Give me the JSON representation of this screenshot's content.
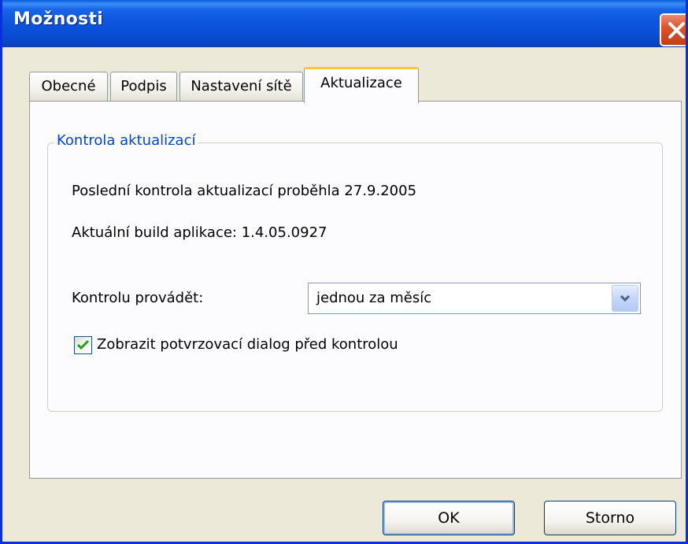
{
  "window": {
    "title": "Možnosti"
  },
  "tabs": [
    {
      "label": "Obecné"
    },
    {
      "label": "Podpis"
    },
    {
      "label": "Nastavení sítě"
    },
    {
      "label": "Aktualizace"
    }
  ],
  "update_group": {
    "legend": "Kontrola aktualizací",
    "last_check": "Poslední kontrola aktualizací proběhla 27.9.2005",
    "build": "Aktuální build aplikace: 1.4.05.0927",
    "frequency_label": "Kontrolu provádět:",
    "frequency_value": "jednou za měsíc",
    "confirm_checkbox_label": "Zobrazit potvrzovací dialog před kontrolou",
    "confirm_checked": true
  },
  "buttons": {
    "ok": "OK",
    "cancel": "Storno"
  },
  "colors": {
    "titlebar": "#0a55dc",
    "close": "#d9522c",
    "active_tab_accent": "#ffc83c",
    "group_legend": "#0046d5",
    "checkmark": "#21a121"
  },
  "icons": {
    "close": "close-icon",
    "dropdown": "chevron-down-icon",
    "check": "checkmark-icon"
  }
}
